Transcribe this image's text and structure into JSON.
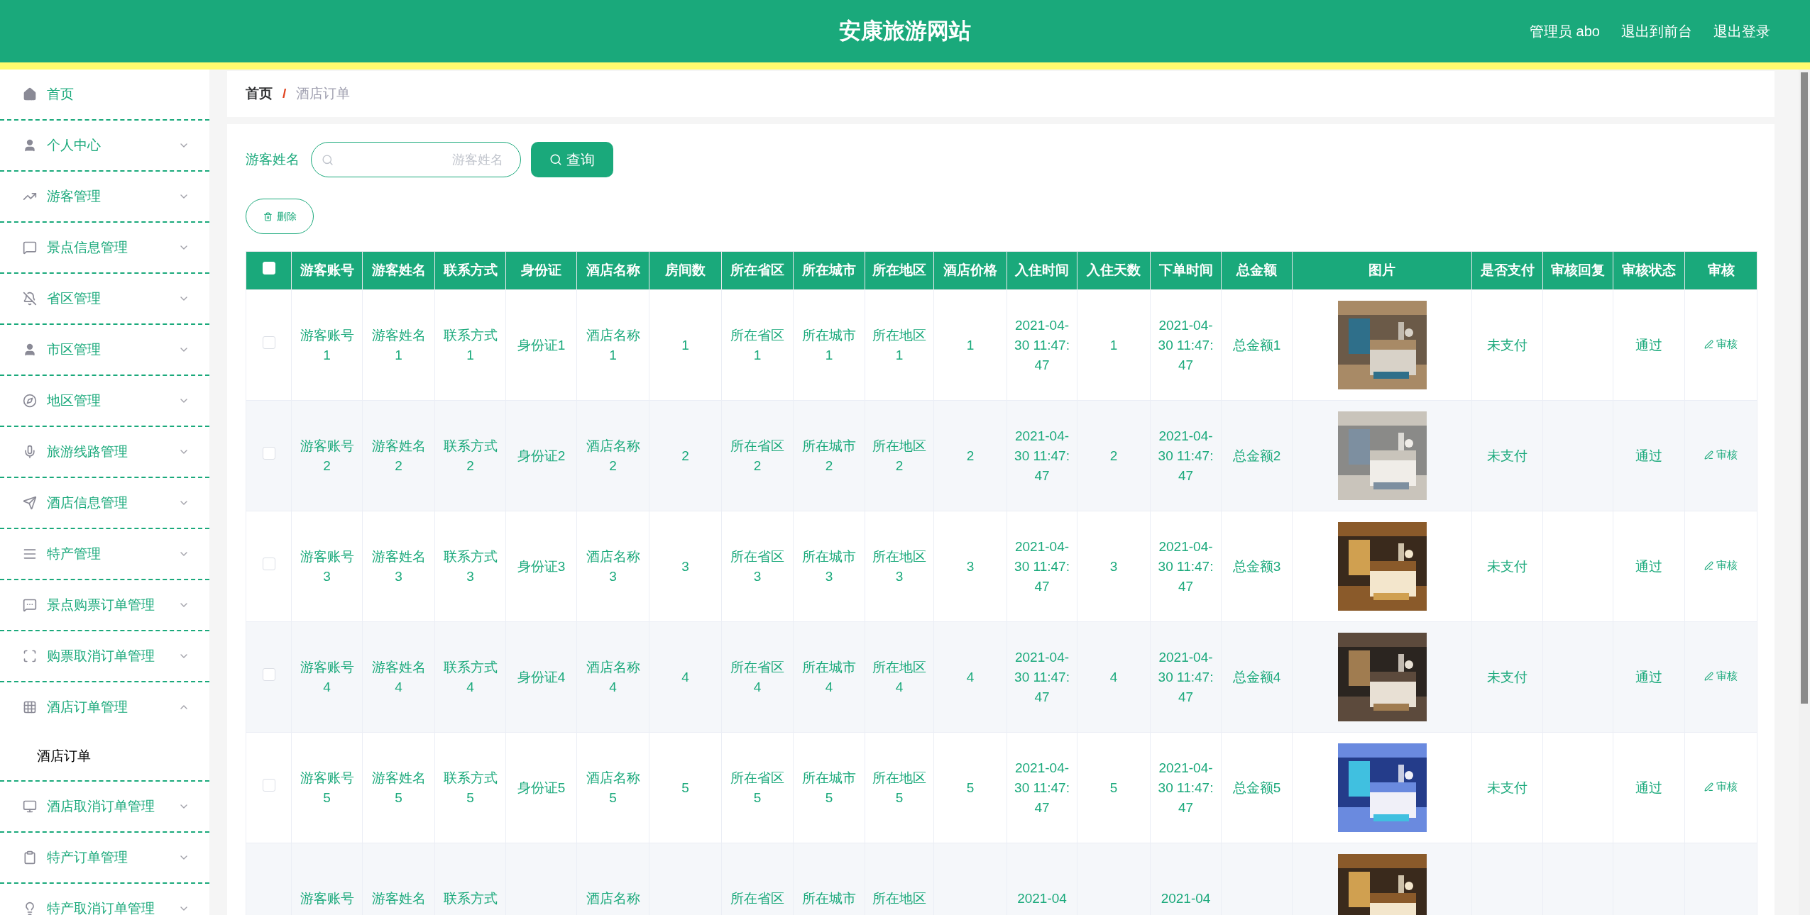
{
  "header": {
    "title": "安康旅游网站",
    "links": [
      "管理员 abo",
      "退出到前台",
      "退出登录"
    ]
  },
  "sidebar": {
    "items": [
      {
        "label": "首页",
        "kind": "link"
      },
      {
        "label": "个人中心",
        "kind": "menu",
        "expanded": false
      },
      {
        "label": "游客管理",
        "kind": "menu",
        "expanded": false
      },
      {
        "label": "景点信息管理",
        "kind": "menu",
        "expanded": false
      },
      {
        "label": "省区管理",
        "kind": "menu",
        "expanded": false
      },
      {
        "label": "市区管理",
        "kind": "menu",
        "expanded": false
      },
      {
        "label": "地区管理",
        "kind": "menu",
        "expanded": false
      },
      {
        "label": "旅游线路管理",
        "kind": "menu",
        "expanded": false
      },
      {
        "label": "酒店信息管理",
        "kind": "menu",
        "expanded": false
      },
      {
        "label": "特产管理",
        "kind": "menu",
        "expanded": false
      },
      {
        "label": "景点购票订单管理",
        "kind": "menu",
        "expanded": false
      },
      {
        "label": "购票取消订单管理",
        "kind": "menu",
        "expanded": false
      },
      {
        "label": "酒店订单管理",
        "kind": "menu",
        "expanded": true,
        "children": [
          {
            "label": "酒店订单",
            "selected": true
          }
        ]
      },
      {
        "label": "酒店取消订单管理",
        "kind": "menu",
        "expanded": false
      },
      {
        "label": "特产订单管理",
        "kind": "menu",
        "expanded": false
      },
      {
        "label": "特产取消订单管理",
        "kind": "menu",
        "expanded": false
      }
    ]
  },
  "breadcrumb": {
    "separator": "/",
    "items": [
      "首页",
      "酒店订单"
    ]
  },
  "search": {
    "label": "游客姓名",
    "placeholder": "游客姓名",
    "button": "查询"
  },
  "delete_button": "删除",
  "table": {
    "select_all": {
      "checked": false
    },
    "columns": [
      "游客账号",
      "游客姓名",
      "联系方式",
      "身份证",
      "酒店名称",
      "房间数",
      "所在省区",
      "所在城市",
      "所在地区",
      "酒店价格",
      "入住时间",
      "入住天数",
      "下单时间",
      "总金额",
      "图片",
      "是否支付",
      "审核回复",
      "审核状态",
      "审核"
    ],
    "rows": [
      {
        "checked": false,
        "account": "游客账号1",
        "name": "游客姓名1",
        "contact": "联系方式1",
        "id_card": "身份证1",
        "hotel": "酒店名称1",
        "rooms": "1",
        "province": "所在省区1",
        "city": "所在城市1",
        "district": "所在地区1",
        "price": "1",
        "checkin": "2021-04-30 11:47:47",
        "days": "1",
        "ordered": "2021-04-30 11:47:47",
        "total": "总金额1",
        "paid": "未支付",
        "status": "通过",
        "action": "审核"
      },
      {
        "checked": false,
        "account": "游客账号2",
        "name": "游客姓名2",
        "contact": "联系方式2",
        "id_card": "身份证2",
        "hotel": "酒店名称2",
        "rooms": "2",
        "province": "所在省区2",
        "city": "所在城市2",
        "district": "所在地区2",
        "price": "2",
        "checkin": "2021-04-30 11:47:47",
        "days": "2",
        "ordered": "2021-04-30 11:47:47",
        "total": "总金额2",
        "paid": "未支付",
        "status": "通过",
        "action": "审核"
      },
      {
        "checked": false,
        "account": "游客账号3",
        "name": "游客姓名3",
        "contact": "联系方式3",
        "id_card": "身份证3",
        "hotel": "酒店名称3",
        "rooms": "3",
        "province": "所在省区3",
        "city": "所在城市3",
        "district": "所在地区3",
        "price": "3",
        "checkin": "2021-04-30 11:47:47",
        "days": "3",
        "ordered": "2021-04-30 11:47:47",
        "total": "总金额3",
        "paid": "未支付",
        "status": "通过",
        "action": "审核"
      },
      {
        "checked": false,
        "account": "游客账号4",
        "name": "游客姓名4",
        "contact": "联系方式4",
        "id_card": "身份证4",
        "hotel": "酒店名称4",
        "rooms": "4",
        "province": "所在省区4",
        "city": "所在城市4",
        "district": "所在地区4",
        "price": "4",
        "checkin": "2021-04-30 11:47:47",
        "days": "4",
        "ordered": "2021-04-30 11:47:47",
        "total": "总金额4",
        "paid": "未支付",
        "status": "通过",
        "action": "审核"
      },
      {
        "checked": false,
        "account": "游客账号5",
        "name": "游客姓名5",
        "contact": "联系方式5",
        "id_card": "身份证5",
        "hotel": "酒店名称5",
        "rooms": "5",
        "province": "所在省区5",
        "city": "所在城市5",
        "district": "所在地区5",
        "price": "5",
        "checkin": "2021-04-30 11:47:47",
        "days": "5",
        "ordered": "2021-04-30 11:47:47",
        "total": "总金额5",
        "paid": "未支付",
        "status": "通过",
        "action": "审核"
      },
      {
        "account": "游客账号",
        "name": "游客姓名",
        "contact": "联系方式",
        "hotel": "酒店名称",
        "province": "所在省区",
        "city": "所在城市",
        "district": "所在地区",
        "checkin": "2021-04",
        "ordered": "2021-04"
      }
    ]
  }
}
